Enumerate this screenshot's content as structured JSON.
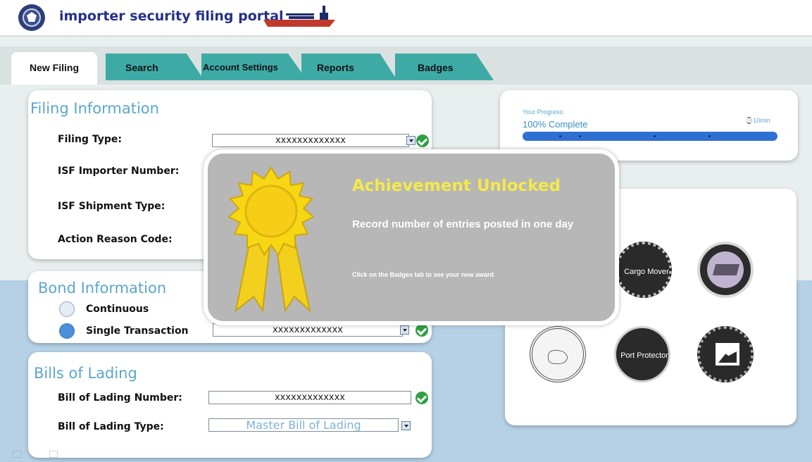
{
  "header": {
    "app_title": "importer security filing portal"
  },
  "tabs": [
    {
      "label": "New Filing",
      "active": true
    },
    {
      "label": "Search"
    },
    {
      "label": "Account Settings"
    },
    {
      "label": "Reports"
    },
    {
      "label": "Badges"
    }
  ],
  "filing_info": {
    "title": "Filing Information",
    "filing_type_label": "Filing Type:",
    "filing_type_value": "xxxxxxxxxxxxx",
    "importer_number_label": "ISF Importer Number:",
    "shipment_type_label": "ISF Shipment Type:",
    "action_reason_label": "Action Reason Code:"
  },
  "bond_info": {
    "title": "Bond Information",
    "continuous_label": "Continuous",
    "single_label": "Single Transaction",
    "selected": "Single Transaction",
    "value": "xxxxxxxxxxxxx"
  },
  "bills": {
    "title": "Bills of Lading",
    "number_label": "Bill of Lading Number:",
    "number_value": "xxxxxxxxxxxxx",
    "type_label": "Bill of Lading Type:",
    "type_value": "Master Bill of Lading"
  },
  "progress": {
    "label": "Your Progress:",
    "text": "100% Complete",
    "time": "⌚10min",
    "percent": 100
  },
  "badges": [
    {
      "label": "Cargo Mover"
    },
    {
      "label": ""
    },
    {
      "label": ""
    },
    {
      "label": "Port Protector"
    },
    {
      "label": ""
    }
  ],
  "achievement": {
    "title": "Achievement Unlocked",
    "description": "Record number of entries posted in one day",
    "hint": "Click on the Badges tab to see your new award"
  },
  "colors": {
    "tab": "#3eaaa6",
    "accent": "#5aa6cf",
    "achievement_title": "#f5e94a",
    "progress": "#2f6fd2"
  }
}
